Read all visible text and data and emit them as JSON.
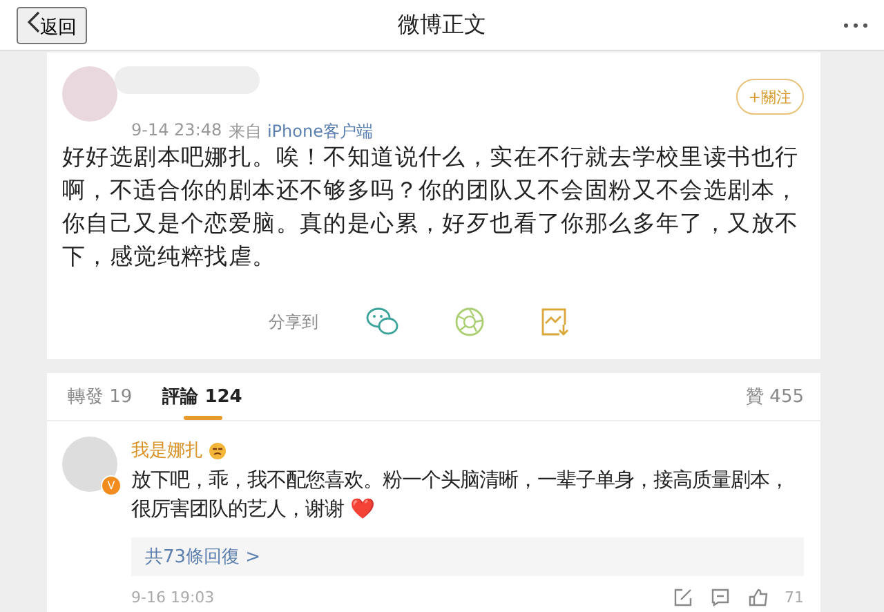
{
  "nav": {
    "back": "返回",
    "title": "微博正文"
  },
  "post": {
    "time": "9-14 23:48",
    "source_prefix": "来自",
    "source": "iPhone客户端",
    "follow": "+關注",
    "text": "好好选剧本吧娜扎。唉！不知道说什么，实在不行就去学校里读书也行啊，不适合你的剧本还不够多吗？你的团队又不会固粉又不会选剧本，你自己又是个恋爱脑。真的是心累，好歹也看了你那么多年了，又放不下，感觉纯粹找虐。",
    "share_label": "分享到"
  },
  "tabs": [
    {
      "label": "轉發 19",
      "selected": false
    },
    {
      "label": "評論 124",
      "selected": true
    }
  ],
  "likes": "贊 455",
  "comment": {
    "user": "我是娜扎",
    "verified": true,
    "badge": "V",
    "text": "放下吧，乖，我不配您喜欢。粉一个头脑清晰，一辈子单身，接高质量剧本，很厉害团队的艺人，谢谢 ❤️",
    "replies": "共73條回復 >",
    "time": "9-16 19:03",
    "like_count": "71"
  }
}
